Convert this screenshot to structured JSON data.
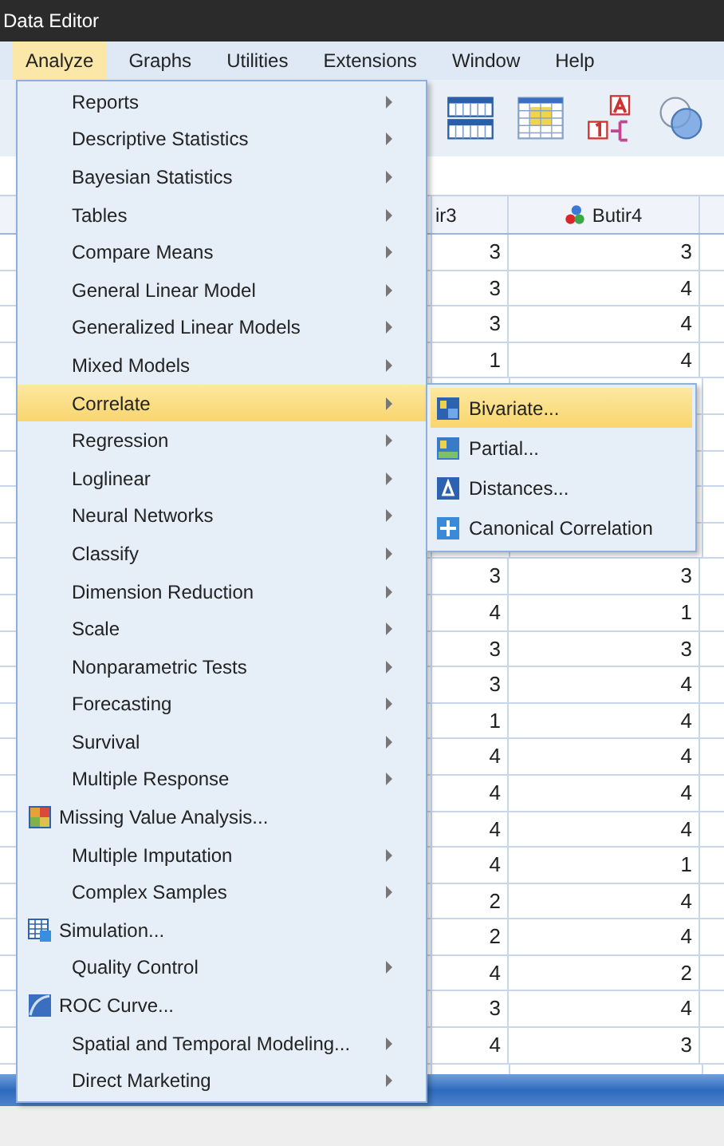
{
  "window": {
    "title": "Data Editor"
  },
  "menubar": [
    {
      "label": "Analyze",
      "selected": true
    },
    {
      "label": "Graphs",
      "selected": false
    },
    {
      "label": "Utilities",
      "selected": false
    },
    {
      "label": "Extensions",
      "selected": false
    },
    {
      "label": "Window",
      "selected": false
    },
    {
      "label": "Help",
      "selected": false
    }
  ],
  "grid": {
    "columns": [
      "ir3",
      "Butir4"
    ],
    "rows": [
      {
        "cells": [
          "3",
          "3"
        ]
      },
      {
        "cells": [
          "3",
          "4"
        ]
      },
      {
        "cells": [
          "3",
          "4"
        ]
      },
      {
        "cells": [
          "1",
          "4"
        ]
      }
    ],
    "rows_below_submenu": [
      {
        "cells": [
          "3",
          "3"
        ]
      },
      {
        "cells": [
          "4",
          "1"
        ]
      },
      {
        "cells": [
          "3",
          "3"
        ]
      },
      {
        "cells": [
          "3",
          "4"
        ]
      },
      {
        "cells": [
          "1",
          "4"
        ]
      },
      {
        "cells": [
          "4",
          "4"
        ]
      },
      {
        "cells": [
          "4",
          "4"
        ]
      },
      {
        "cells": [
          "4",
          "4"
        ]
      },
      {
        "cells": [
          "4",
          "1"
        ]
      },
      {
        "cells": [
          "2",
          "4"
        ]
      },
      {
        "cells": [
          "2",
          "4"
        ]
      },
      {
        "cells": [
          "4",
          "2"
        ]
      },
      {
        "cells": [
          "3",
          "4"
        ]
      },
      {
        "cells": [
          "4",
          "3"
        ]
      }
    ]
  },
  "menu": [
    {
      "label": "Reports",
      "kind": "submenu",
      "selected": false
    },
    {
      "label": "Descriptive Statistics",
      "kind": "submenu",
      "selected": false
    },
    {
      "label": "Bayesian Statistics",
      "kind": "submenu",
      "selected": false
    },
    {
      "label": "Tables",
      "kind": "submenu",
      "selected": false
    },
    {
      "label": "Compare Means",
      "kind": "submenu",
      "selected": false
    },
    {
      "label": "General Linear Model",
      "kind": "submenu",
      "selected": false
    },
    {
      "label": "Generalized Linear Models",
      "kind": "submenu",
      "selected": false
    },
    {
      "label": "Mixed Models",
      "kind": "submenu",
      "selected": false
    },
    {
      "label": "Correlate",
      "kind": "submenu",
      "selected": true
    },
    {
      "label": "Regression",
      "kind": "submenu",
      "selected": false
    },
    {
      "label": "Loglinear",
      "kind": "submenu",
      "selected": false
    },
    {
      "label": "Neural Networks",
      "kind": "submenu",
      "selected": false
    },
    {
      "label": "Classify",
      "kind": "submenu",
      "selected": false
    },
    {
      "label": "Dimension Reduction",
      "kind": "submenu",
      "selected": false
    },
    {
      "label": "Scale",
      "kind": "submenu",
      "selected": false
    },
    {
      "label": "Nonparametric Tests",
      "kind": "submenu",
      "selected": false
    },
    {
      "label": "Forecasting",
      "kind": "submenu",
      "selected": false
    },
    {
      "label": "Survival",
      "kind": "submenu",
      "selected": false
    },
    {
      "label": "Multiple Response",
      "kind": "submenu",
      "selected": false
    },
    {
      "label": "Missing Value Analysis...",
      "kind": "dialog",
      "selected": false
    },
    {
      "label": "Multiple Imputation",
      "kind": "submenu",
      "selected": false
    },
    {
      "label": "Complex Samples",
      "kind": "submenu",
      "selected": false
    },
    {
      "label": "Simulation...",
      "kind": "dialog",
      "selected": false
    },
    {
      "label": "Quality Control",
      "kind": "submenu",
      "selected": false
    },
    {
      "label": "ROC Curve...",
      "kind": "dialog",
      "selected": false
    },
    {
      "label": "Spatial and Temporal Modeling...",
      "kind": "submenu",
      "selected": false
    },
    {
      "label": "Direct Marketing",
      "kind": "submenu",
      "selected": false
    }
  ],
  "submenu": [
    {
      "label": "Bivariate...",
      "selected": true
    },
    {
      "label": "Partial...",
      "selected": false
    },
    {
      "label": "Distances...",
      "selected": false
    },
    {
      "label": "Canonical Correlation",
      "selected": false
    }
  ]
}
